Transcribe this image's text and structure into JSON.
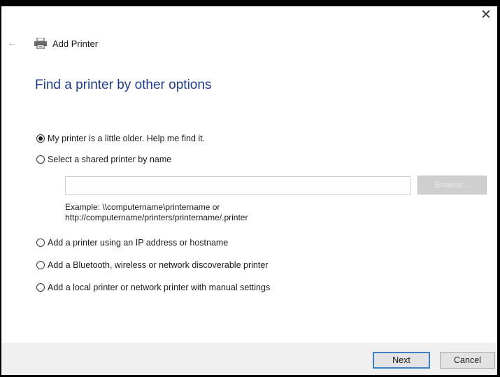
{
  "window": {
    "close_glyph": "✕",
    "back_glyph": "←",
    "title": "Add Printer"
  },
  "heading": "Find a printer by other options",
  "options": [
    {
      "label": "My printer is a little older. Help me find it.",
      "checked": true
    },
    {
      "label": "Select a shared printer by name",
      "checked": false
    },
    {
      "label": "Add a printer using an IP address or hostname",
      "checked": false
    },
    {
      "label": "Add a Bluetooth, wireless or network discoverable printer",
      "checked": false
    },
    {
      "label": "Add a local printer or network printer with manual settings",
      "checked": false
    }
  ],
  "shared_printer": {
    "value": "",
    "browse_label": "Browse...",
    "example_line1": "Example: \\\\computername\\printername or",
    "example_line2": "http://computername/printers/printername/.printer"
  },
  "footer": {
    "next_label": "Next",
    "cancel_label": "Cancel"
  },
  "colors": {
    "heading": "#1e3d8f",
    "focus_border": "#3c7fc5",
    "footer_bg": "#f0f0f0"
  },
  "icons": {
    "title": "printer-icon",
    "close": "close-icon",
    "back": "back-arrow-icon"
  }
}
